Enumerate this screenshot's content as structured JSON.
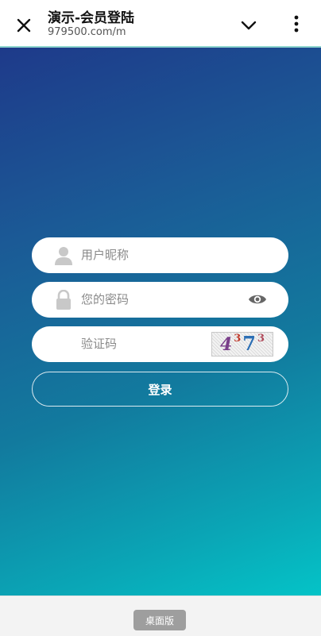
{
  "browser": {
    "title": "演示-会员登陆",
    "url": "979500.com/m"
  },
  "form": {
    "username_placeholder": "用户昵称",
    "password_placeholder": "您的密码",
    "captcha_placeholder": "验证码",
    "captcha_chars": [
      "4",
      "3",
      "7",
      "3"
    ],
    "login_label": "登录"
  },
  "footer": {
    "desktop_label": "桌面版"
  },
  "colors": {
    "gradient_start": "#1e3a8a",
    "gradient_end": "#04c3c7",
    "icon_gray": "#c8c8c8"
  }
}
